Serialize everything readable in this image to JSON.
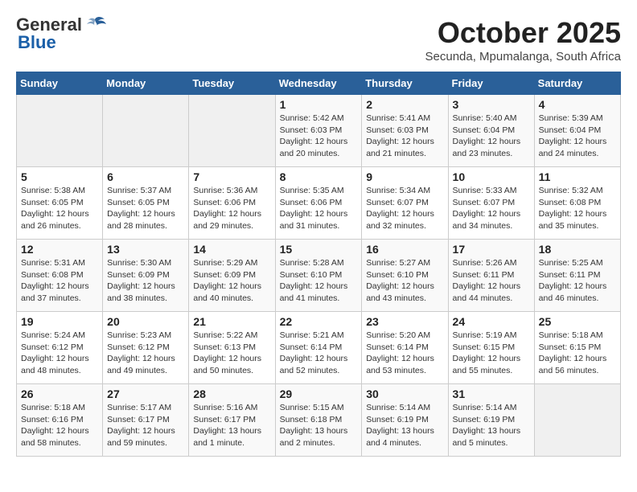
{
  "header": {
    "logo_general": "General",
    "logo_blue": "Blue",
    "month_title": "October 2025",
    "subtitle": "Secunda, Mpumalanga, South Africa"
  },
  "weekdays": [
    "Sunday",
    "Monday",
    "Tuesday",
    "Wednesday",
    "Thursday",
    "Friday",
    "Saturday"
  ],
  "weeks": [
    [
      {
        "day": "",
        "info": ""
      },
      {
        "day": "",
        "info": ""
      },
      {
        "day": "",
        "info": ""
      },
      {
        "day": "1",
        "info": "Sunrise: 5:42 AM\nSunset: 6:03 PM\nDaylight: 12 hours\nand 20 minutes."
      },
      {
        "day": "2",
        "info": "Sunrise: 5:41 AM\nSunset: 6:03 PM\nDaylight: 12 hours\nand 21 minutes."
      },
      {
        "day": "3",
        "info": "Sunrise: 5:40 AM\nSunset: 6:04 PM\nDaylight: 12 hours\nand 23 minutes."
      },
      {
        "day": "4",
        "info": "Sunrise: 5:39 AM\nSunset: 6:04 PM\nDaylight: 12 hours\nand 24 minutes."
      }
    ],
    [
      {
        "day": "5",
        "info": "Sunrise: 5:38 AM\nSunset: 6:05 PM\nDaylight: 12 hours\nand 26 minutes."
      },
      {
        "day": "6",
        "info": "Sunrise: 5:37 AM\nSunset: 6:05 PM\nDaylight: 12 hours\nand 28 minutes."
      },
      {
        "day": "7",
        "info": "Sunrise: 5:36 AM\nSunset: 6:06 PM\nDaylight: 12 hours\nand 29 minutes."
      },
      {
        "day": "8",
        "info": "Sunrise: 5:35 AM\nSunset: 6:06 PM\nDaylight: 12 hours\nand 31 minutes."
      },
      {
        "day": "9",
        "info": "Sunrise: 5:34 AM\nSunset: 6:07 PM\nDaylight: 12 hours\nand 32 minutes."
      },
      {
        "day": "10",
        "info": "Sunrise: 5:33 AM\nSunset: 6:07 PM\nDaylight: 12 hours\nand 34 minutes."
      },
      {
        "day": "11",
        "info": "Sunrise: 5:32 AM\nSunset: 6:08 PM\nDaylight: 12 hours\nand 35 minutes."
      }
    ],
    [
      {
        "day": "12",
        "info": "Sunrise: 5:31 AM\nSunset: 6:08 PM\nDaylight: 12 hours\nand 37 minutes."
      },
      {
        "day": "13",
        "info": "Sunrise: 5:30 AM\nSunset: 6:09 PM\nDaylight: 12 hours\nand 38 minutes."
      },
      {
        "day": "14",
        "info": "Sunrise: 5:29 AM\nSunset: 6:09 PM\nDaylight: 12 hours\nand 40 minutes."
      },
      {
        "day": "15",
        "info": "Sunrise: 5:28 AM\nSunset: 6:10 PM\nDaylight: 12 hours\nand 41 minutes."
      },
      {
        "day": "16",
        "info": "Sunrise: 5:27 AM\nSunset: 6:10 PM\nDaylight: 12 hours\nand 43 minutes."
      },
      {
        "day": "17",
        "info": "Sunrise: 5:26 AM\nSunset: 6:11 PM\nDaylight: 12 hours\nand 44 minutes."
      },
      {
        "day": "18",
        "info": "Sunrise: 5:25 AM\nSunset: 6:11 PM\nDaylight: 12 hours\nand 46 minutes."
      }
    ],
    [
      {
        "day": "19",
        "info": "Sunrise: 5:24 AM\nSunset: 6:12 PM\nDaylight: 12 hours\nand 48 minutes."
      },
      {
        "day": "20",
        "info": "Sunrise: 5:23 AM\nSunset: 6:12 PM\nDaylight: 12 hours\nand 49 minutes."
      },
      {
        "day": "21",
        "info": "Sunrise: 5:22 AM\nSunset: 6:13 PM\nDaylight: 12 hours\nand 50 minutes."
      },
      {
        "day": "22",
        "info": "Sunrise: 5:21 AM\nSunset: 6:14 PM\nDaylight: 12 hours\nand 52 minutes."
      },
      {
        "day": "23",
        "info": "Sunrise: 5:20 AM\nSunset: 6:14 PM\nDaylight: 12 hours\nand 53 minutes."
      },
      {
        "day": "24",
        "info": "Sunrise: 5:19 AM\nSunset: 6:15 PM\nDaylight: 12 hours\nand 55 minutes."
      },
      {
        "day": "25",
        "info": "Sunrise: 5:18 AM\nSunset: 6:15 PM\nDaylight: 12 hours\nand 56 minutes."
      }
    ],
    [
      {
        "day": "26",
        "info": "Sunrise: 5:18 AM\nSunset: 6:16 PM\nDaylight: 12 hours\nand 58 minutes."
      },
      {
        "day": "27",
        "info": "Sunrise: 5:17 AM\nSunset: 6:17 PM\nDaylight: 12 hours\nand 59 minutes."
      },
      {
        "day": "28",
        "info": "Sunrise: 5:16 AM\nSunset: 6:17 PM\nDaylight: 13 hours\nand 1 minute."
      },
      {
        "day": "29",
        "info": "Sunrise: 5:15 AM\nSunset: 6:18 PM\nDaylight: 13 hours\nand 2 minutes."
      },
      {
        "day": "30",
        "info": "Sunrise: 5:14 AM\nSunset: 6:19 PM\nDaylight: 13 hours\nand 4 minutes."
      },
      {
        "day": "31",
        "info": "Sunrise: 5:14 AM\nSunset: 6:19 PM\nDaylight: 13 hours\nand 5 minutes."
      },
      {
        "day": "",
        "info": ""
      }
    ]
  ]
}
